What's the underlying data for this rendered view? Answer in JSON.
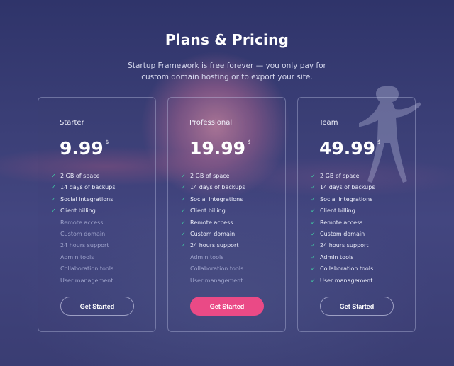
{
  "header": {
    "title": "Plans & Pricing",
    "subtitle": "Startup Framework is free forever — you only pay for custom domain hosting or to export your site."
  },
  "colors": {
    "accent": "#ea4a86",
    "check": "#41d3a6"
  },
  "plans": [
    {
      "name": "Starter",
      "price": "9.99",
      "currency": "$",
      "button_label": "Get Started",
      "features": [
        {
          "label": "2 GB of space",
          "included": true
        },
        {
          "label": "14 days of backups",
          "included": true
        },
        {
          "label": "Social integrations",
          "included": true
        },
        {
          "label": "Client billing",
          "included": true
        },
        {
          "label": "Remote access",
          "included": false
        },
        {
          "label": "Custom domain",
          "included": false
        },
        {
          "label": "24 hours support",
          "included": false
        },
        {
          "label": "Admin tools",
          "included": false
        },
        {
          "label": "Collaboration tools",
          "included": false
        },
        {
          "label": "User management",
          "included": false
        }
      ]
    },
    {
      "name": "Professional",
      "price": "19.99",
      "currency": "$",
      "button_label": "Get Started",
      "features": [
        {
          "label": "2 GB of space",
          "included": true
        },
        {
          "label": "14 days of backups",
          "included": true
        },
        {
          "label": "Social integrations",
          "included": true
        },
        {
          "label": "Client billing",
          "included": true
        },
        {
          "label": "Remote access",
          "included": true
        },
        {
          "label": "Custom domain",
          "included": true
        },
        {
          "label": "24 hours support",
          "included": true
        },
        {
          "label": "Admin tools",
          "included": false
        },
        {
          "label": "Collaboration tools",
          "included": false
        },
        {
          "label": "User management",
          "included": false
        }
      ]
    },
    {
      "name": "Team",
      "price": "49.99",
      "currency": "$",
      "button_label": "Get Started",
      "features": [
        {
          "label": "2 GB of space",
          "included": true
        },
        {
          "label": "14 days of backups",
          "included": true
        },
        {
          "label": "Social integrations",
          "included": true
        },
        {
          "label": "Client billing",
          "included": true
        },
        {
          "label": "Remote access",
          "included": true
        },
        {
          "label": "Custom domain",
          "included": true
        },
        {
          "label": "24 hours support",
          "included": true
        },
        {
          "label": "Admin tools",
          "included": true
        },
        {
          "label": "Collaboration tools",
          "included": true
        },
        {
          "label": "User management",
          "included": true
        }
      ]
    }
  ]
}
